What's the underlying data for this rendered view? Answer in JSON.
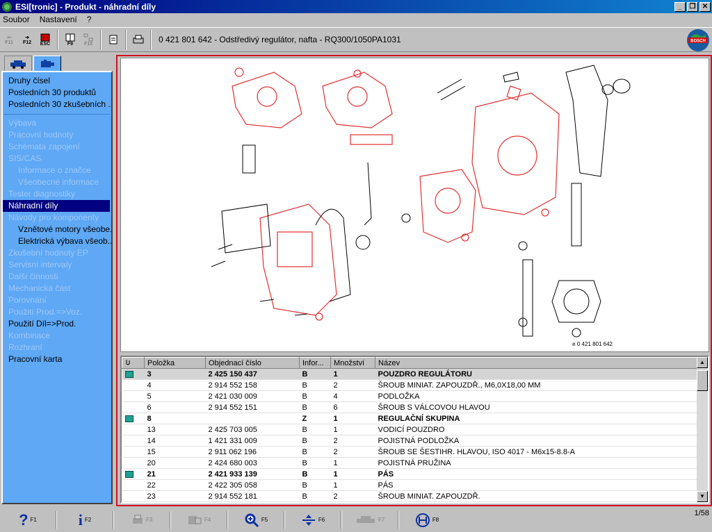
{
  "window": {
    "title": "ESI[tronic] - Produkt - náhradní díly"
  },
  "menu": [
    "Soubor",
    "Nastavení",
    "?"
  ],
  "toolbar": {
    "f11": "F11",
    "f12": "F12",
    "esc": "ESC",
    "f9": "F9",
    "f10": "F10",
    "product": "0 421 801 642 - Odstředivý regulátor, nafta - RQ300/1050PA1031"
  },
  "nav": {
    "items": [
      {
        "label": "Druhy čísel",
        "state": "normal"
      },
      {
        "label": "Posledních 30 produktů",
        "state": "normal"
      },
      {
        "label": "Posledních 30 zkušebních ...",
        "state": "normal"
      },
      {
        "label": "Výbava",
        "state": "dim"
      },
      {
        "label": "Pracovní hodnoty",
        "state": "dim"
      },
      {
        "label": "Schémata zapojení",
        "state": "dim"
      },
      {
        "label": "SIS/CAS",
        "state": "dim"
      },
      {
        "label": "Informace o značce",
        "state": "dim-sub"
      },
      {
        "label": "Všeobecné informace",
        "state": "dim-sub"
      },
      {
        "label": "Tester diagnostiky",
        "state": "dim"
      },
      {
        "label": "Náhradní díly",
        "state": "selected"
      },
      {
        "label": "Návody pro komponenty",
        "state": "dim"
      },
      {
        "label": "Vznětové motory všeobe...",
        "state": "sub"
      },
      {
        "label": "Elektrická výbava všeob...",
        "state": "sub"
      },
      {
        "label": "Zkušební hodnoty EP",
        "state": "dim"
      },
      {
        "label": "Servisní intervaly",
        "state": "dim"
      },
      {
        "label": "Další činnosti",
        "state": "dim"
      },
      {
        "label": "Mechanická část",
        "state": "dim"
      },
      {
        "label": "Porovnání",
        "state": "dim"
      },
      {
        "label": "Použití Prod.=>Voz.",
        "state": "dim"
      },
      {
        "label": "Použití Díl=>Prod.",
        "state": "normal"
      },
      {
        "label": "Kombinace",
        "state": "dim"
      },
      {
        "label": "Rozhraní",
        "state": "dim"
      },
      {
        "label": "Pracovní karta",
        "state": "normal"
      }
    ]
  },
  "drawing": {
    "caption": "e 0 421 801 642"
  },
  "table": {
    "columns": [
      "Položka",
      "Objednací číslo",
      "Infor...",
      "Množství",
      "Název"
    ],
    "rows": [
      {
        "pos": "3",
        "num": "2 425 150 437",
        "info": "B",
        "qty": "1",
        "name": "POUZDRO REGULÁTORU",
        "bold": true,
        "book": true
      },
      {
        "pos": "4",
        "num": "2 914 552 158",
        "info": "B",
        "qty": "2",
        "name": "ŠROUB MINIAT. ZAPOUZDŘ.,   M6,0X18,00 MM",
        "bold": false,
        "book": false
      },
      {
        "pos": "5",
        "num": "2 421 030 009",
        "info": "B",
        "qty": "4",
        "name": "PODLOŽKA",
        "bold": false,
        "book": false
      },
      {
        "pos": "6",
        "num": "2 914 552 151",
        "info": "B",
        "qty": "6",
        "name": "ŠROUB S VÁLCOVOU HLAVOU",
        "bold": false,
        "book": false
      },
      {
        "pos": "8",
        "num": "",
        "info": "Z",
        "qty": "1",
        "name": "REGULAČNÍ SKUPINA",
        "bold": true,
        "book": true
      },
      {
        "pos": "13",
        "num": "2 425 703 005",
        "info": "B",
        "qty": "1",
        "name": "VODICÍ POUZDRO",
        "bold": false,
        "book": false
      },
      {
        "pos": "14",
        "num": "1 421 331 009",
        "info": "B",
        "qty": "2",
        "name": "POJISTNÁ PODLOŽKA",
        "bold": false,
        "book": false
      },
      {
        "pos": "15",
        "num": "2 911 062 196",
        "info": "B",
        "qty": "2",
        "name": "ŠROUB SE ŠESTIHR. HLAVOU,   ISO 4017 - M6x15-8.8-A",
        "bold": false,
        "book": false
      },
      {
        "pos": "20",
        "num": "2 424 680 003",
        "info": "B",
        "qty": "1",
        "name": "POJISTNÁ PRUŽINA",
        "bold": false,
        "book": false
      },
      {
        "pos": "21",
        "num": "2 421 933 139",
        "info": "B",
        "qty": "1",
        "name": "PÁS",
        "bold": true,
        "book": true
      },
      {
        "pos": "22",
        "num": "2 422 305 058",
        "info": "B",
        "qty": "1",
        "name": "PÁS",
        "bold": false,
        "book": false
      },
      {
        "pos": "23",
        "num": "2 914 552 181",
        "info": "B",
        "qty": "2",
        "name": "ŠROUB MINIAT. ZAPOUZDŘ.",
        "bold": false,
        "book": false
      }
    ]
  },
  "fkeys": [
    {
      "icon": "help-icon",
      "key": "F1"
    },
    {
      "icon": "info-icon",
      "key": "F2"
    },
    {
      "icon": "print-icon",
      "key": "F3"
    },
    {
      "icon": "parts-icon",
      "key": "F4"
    },
    {
      "icon": "zoom-icon",
      "key": "F5"
    },
    {
      "icon": "split-icon",
      "key": "F6"
    },
    {
      "icon": "vehicle-icon",
      "key": "F7"
    },
    {
      "icon": "bosch-icon",
      "key": "F8"
    }
  ],
  "status": {
    "page": "1/58"
  }
}
